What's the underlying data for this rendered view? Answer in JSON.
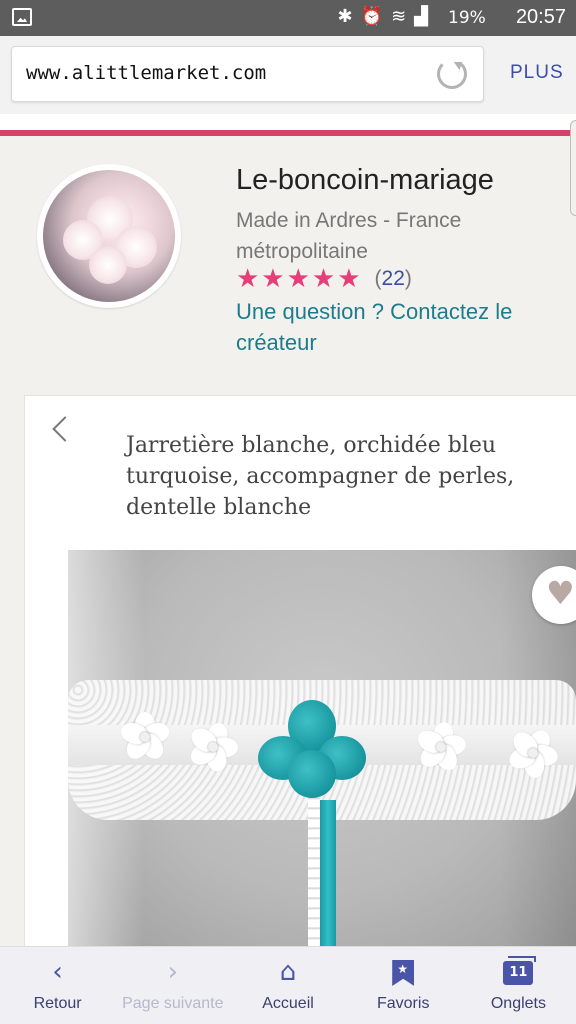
{
  "status_bar": {
    "icons": [
      "picture-icon",
      "bluetooth-icon",
      "alarm-icon",
      "wifi-icon",
      "signal-icon"
    ],
    "battery": "19%",
    "time": "20:57"
  },
  "browser": {
    "url": "www.alittlemarket.com",
    "more_label": "PLUS"
  },
  "shop": {
    "name": "Le-boncoin-mariage",
    "location": "Made in Ardres - France métropolitaine",
    "stars": "★★★★★",
    "rating": 5,
    "review_open": "(",
    "review_count": "22",
    "review_close": ")",
    "contact_label": "Une question ? Contactez le créateur"
  },
  "product": {
    "title": "Jarretière blanche, orchidée bleu turquoise, accompagner de perles, dentelle blanche",
    "favorite_icon": "heart-icon"
  },
  "bottom_nav": {
    "items": [
      {
        "label": "Retour",
        "icon": "‹"
      },
      {
        "label": "Page suivante",
        "icon": "›"
      },
      {
        "label": "Accueil",
        "icon": "⌂"
      },
      {
        "label": "Favoris",
        "icon": "bookmark-icon"
      },
      {
        "label": "Onglets",
        "icon": "11"
      }
    ]
  },
  "colors": {
    "accent_pink": "#d44369",
    "star_pink": "#e63e78",
    "link_teal": "#1b7d8c",
    "nav_blue": "#4a55a8"
  }
}
